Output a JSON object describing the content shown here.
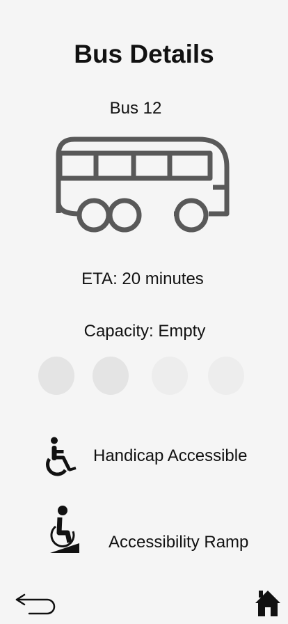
{
  "header": {
    "title": "Bus Details"
  },
  "bus": {
    "name": "Bus 12",
    "eta": "ETA: 20 minutes",
    "capacity": "Capacity: Empty"
  },
  "capacity_indicator": {
    "filled": 2,
    "total": 4
  },
  "features": [
    {
      "label": "Handicap Accessible",
      "icon": "wheelchair-icon"
    },
    {
      "label": "Accessibility Ramp",
      "icon": "wheelchair-ramp-icon"
    }
  ],
  "nav": {
    "back_icon": "back-arrow-icon",
    "home_icon": "home-icon"
  },
  "colors": {
    "background": "#f5f5f5",
    "bus_stroke": "#595959",
    "dot_filled": "#e4e4e4",
    "dot_empty": "#ededed"
  }
}
